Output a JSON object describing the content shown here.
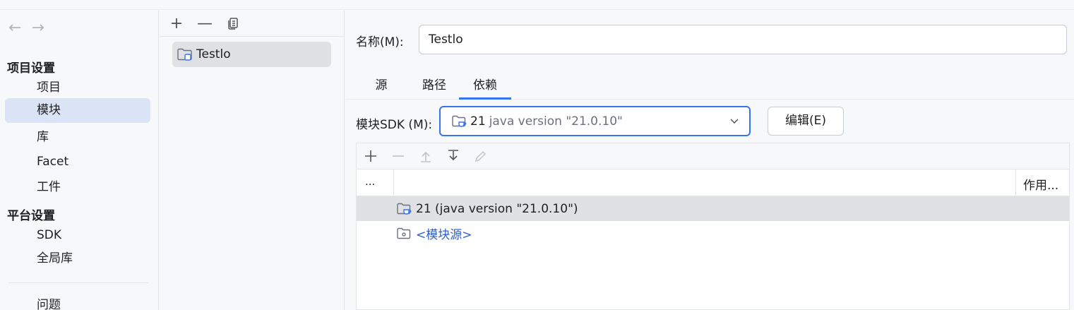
{
  "nav": {
    "back_arrow": "←",
    "forward_arrow": "→",
    "project_settings_header": "项目设置",
    "project_items": [
      "项目",
      "模块",
      "库",
      "Facet",
      "工件"
    ],
    "platform_settings_header": "平台设置",
    "platform_items": [
      "SDK",
      "全局库"
    ],
    "problems": "问题",
    "selected": "模块"
  },
  "modules": {
    "toolbar": {
      "add": "+",
      "remove": "—",
      "copy_icon": "copy-icon"
    },
    "items": [
      "Testlo"
    ]
  },
  "module_detail": {
    "name_label": "名称(M):",
    "name_value": "Testlo",
    "tabs": [
      "源",
      "路径",
      "依赖"
    ],
    "active_tab": "依赖",
    "sdk_label": "模块SDK (M):",
    "sdk_version": "21",
    "sdk_detail": "java version \"21.0.10\"",
    "edit_button": "编辑(E)",
    "dependencies": {
      "col_dots": "...",
      "col_scope": "作用...",
      "rows": [
        {
          "icon": "jdk-folder-icon",
          "text": "21 (java version \"21.0.10\")"
        },
        {
          "icon": "source-folder-icon",
          "text": "<模块源>"
        }
      ]
    }
  },
  "colors": {
    "accent": "#3574f0",
    "selected_nav": "#dbe4f6",
    "link": "#2f5ec7"
  }
}
